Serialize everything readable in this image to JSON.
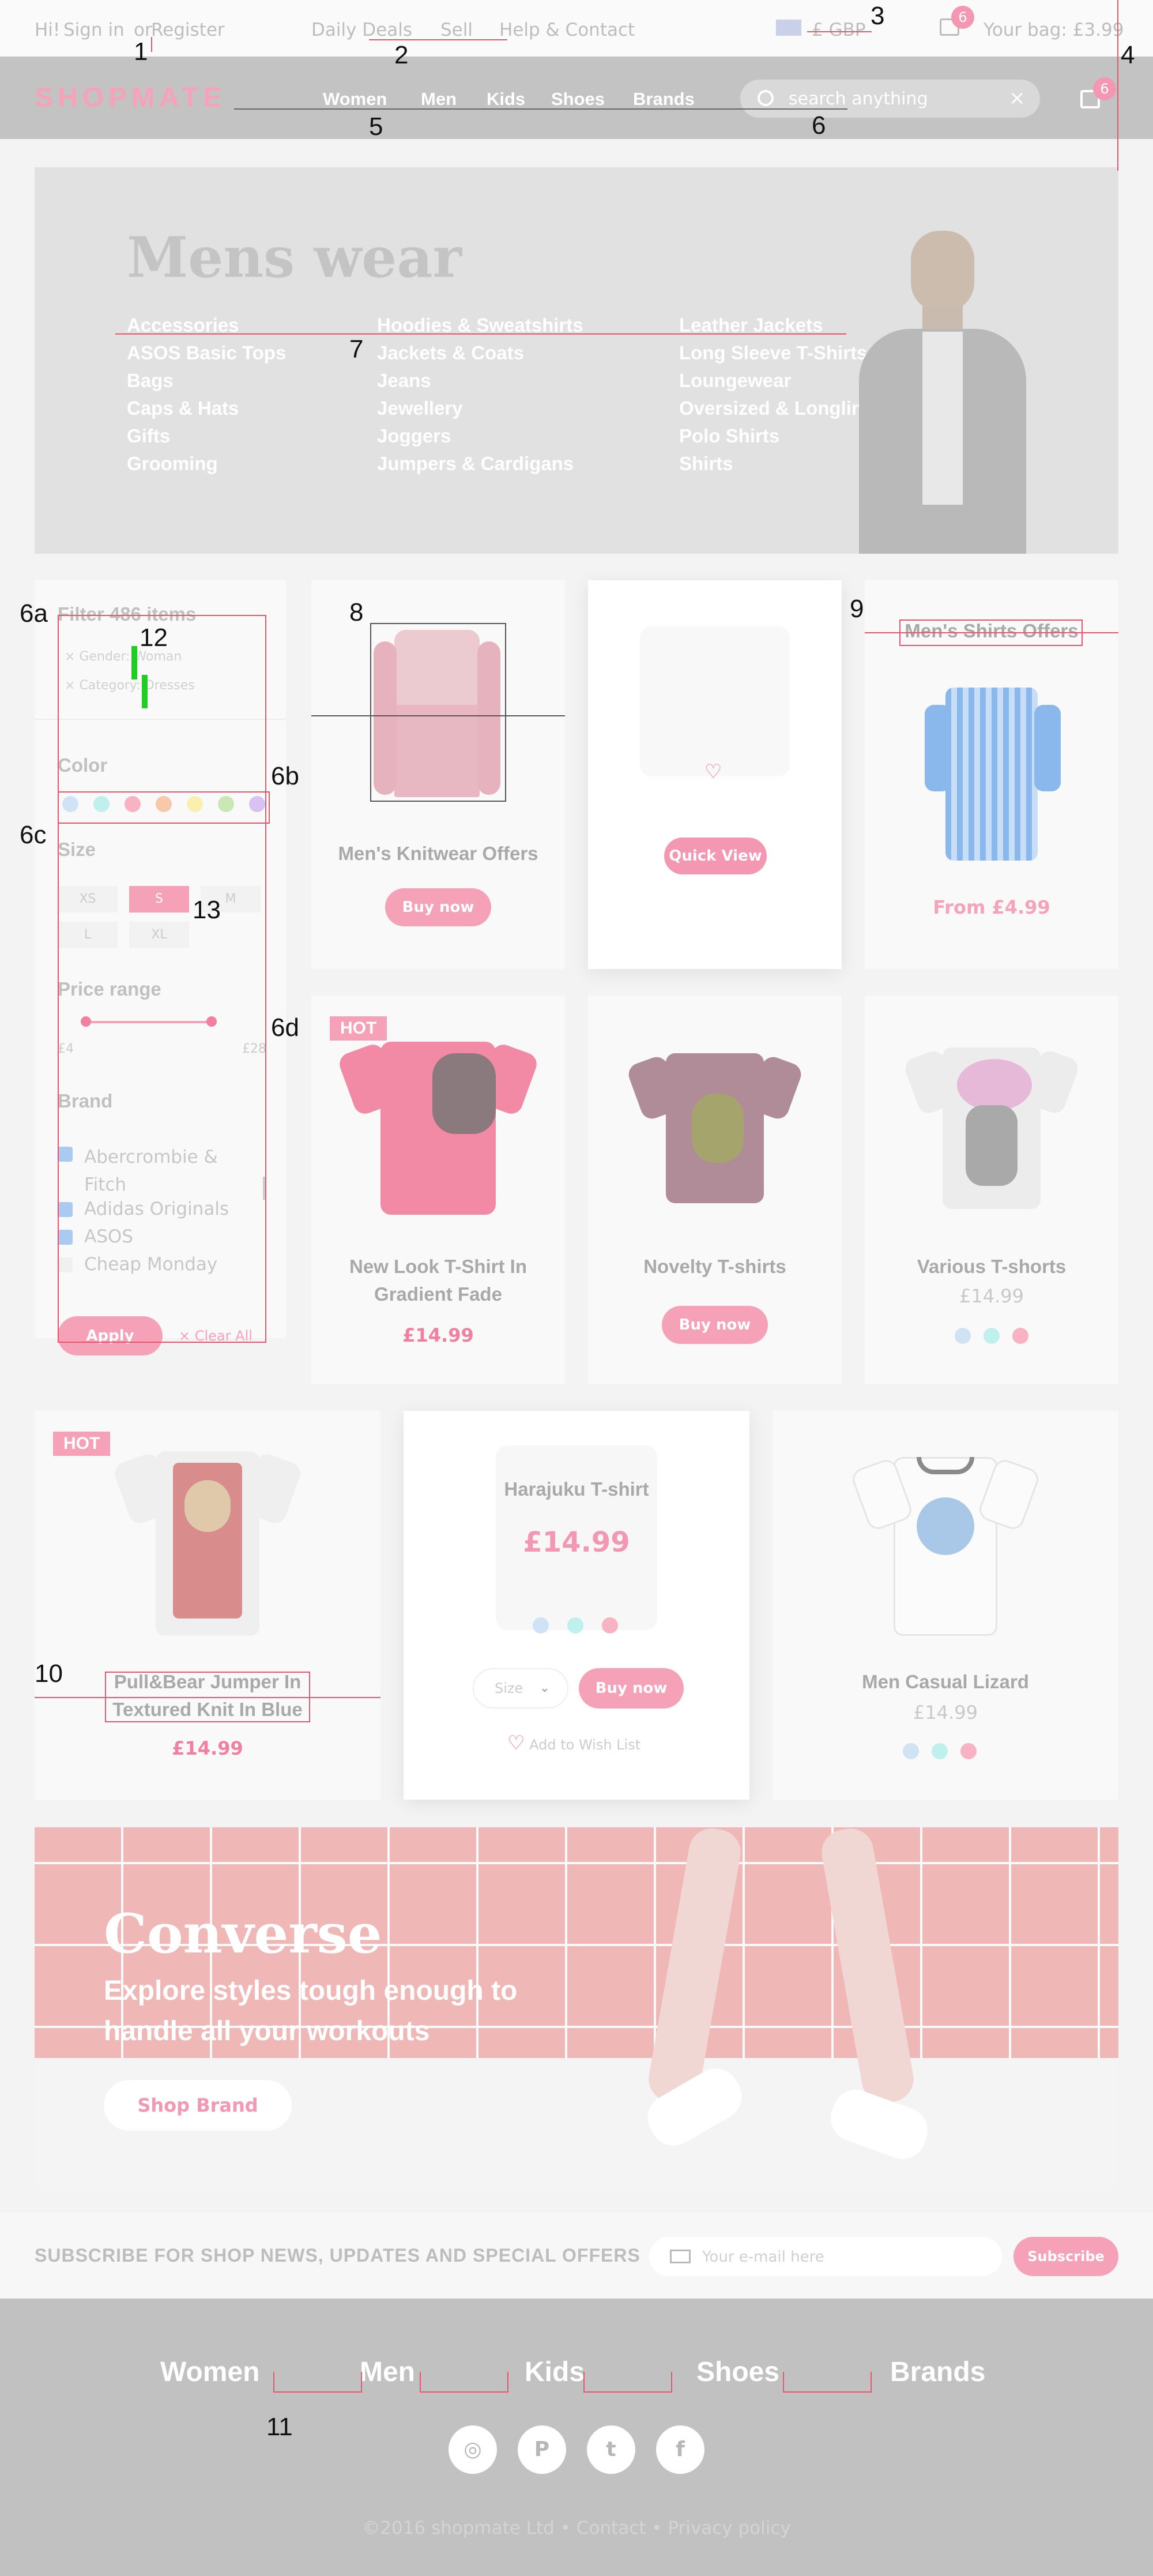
{
  "topbar": {
    "greeting": "Hi!",
    "sign_in": "Sign in",
    "or": "or",
    "register": "Register",
    "daily_deals": "Daily Deals",
    "sell": "Sell",
    "help": "Help & Contact",
    "currency": "£ GBP",
    "bag_count": "6",
    "bag_text": "Your bag: £3.99"
  },
  "nav": {
    "logo": "SHOPMATE",
    "items": [
      "Women",
      "Men",
      "Kids",
      "Shoes",
      "Brands"
    ],
    "search_placeholder": "search anything",
    "bag_count": "6"
  },
  "hero": {
    "title": "Mens wear",
    "col1": [
      "Accessories",
      "ASOS Basic Tops",
      "Bags",
      "Caps & Hats",
      "Gifts",
      "Grooming"
    ],
    "col2": [
      "Hoodies & Sweatshirts",
      "Jackets & Coats",
      "Jeans",
      "Jewellery",
      "Joggers",
      "Jumpers & Cardigans"
    ],
    "col3": [
      "Leather Jackets",
      "Long Sleeve T-Shirts",
      "Loungewear",
      "Oversized & Longline",
      "Polo Shirts",
      "Shirts"
    ]
  },
  "filter": {
    "title": "Filter 486 items",
    "tags": [
      "Gender: Woman",
      "Category: Dresses"
    ],
    "color_label": "Color",
    "colors": [
      "#cfe3f5",
      "#bff0ee",
      "#f7b3c4",
      "#f8c9a8",
      "#f9f0b0",
      "#c9e8b6",
      "#d8c2f3"
    ],
    "size_label": "Size",
    "sizes": [
      "XS",
      "S",
      "M",
      "L",
      "XL"
    ],
    "price_label": "Price range",
    "price_min": "£4",
    "price_max": "£28",
    "brand_label": "Brand",
    "brands": [
      "Abercrombie & Fitch",
      "Adidas Originals",
      "ASOS",
      "Cheap Monday"
    ],
    "brands_checked": [
      1,
      1,
      1,
      0
    ],
    "apply": "Apply",
    "clear": "Clear All"
  },
  "products": {
    "p1": {
      "title": "Men's Knitwear Offers",
      "button": "Buy now"
    },
    "p2": {
      "button": "Quick View"
    },
    "p3": {
      "title": "Men's Shirts Offers",
      "price": "From £4.99"
    },
    "p4": {
      "badge": "HOT",
      "title": "New Look T-Shirt In Gradient Fade",
      "price": "£14.99"
    },
    "p5": {
      "title": "Novelty T-shirts",
      "button": "Buy now"
    },
    "p6": {
      "title": "Various T-shorts",
      "price": "£14.99",
      "colors": [
        "#cfe3f5",
        "#bff0ee",
        "#f7b3c4"
      ]
    },
    "p7": {
      "badge": "HOT",
      "title": "Pull&Bear Jumper In Textured Knit In Blue",
      "price": "£14.99"
    },
    "p8": {
      "title": "Harajuku T-shirt",
      "price": "£14.99",
      "colors": [
        "#cfe3f5",
        "#bff0ee",
        "#f7b3c4"
      ],
      "size": "Size",
      "button": "Buy now",
      "wishlist": "Add to Wish List"
    },
    "p9": {
      "title": "Men Casual Lizard",
      "price": "£14.99",
      "colors": [
        "#cfe3f5",
        "#bff0ee",
        "#f7b3c4"
      ]
    }
  },
  "banner": {
    "title": "Converse",
    "subtitle1": "Explore styles tough enough to",
    "subtitle2": "handle all your workouts",
    "button": "Shop Brand"
  },
  "subscribe": {
    "text": "SUBSCRIBE FOR SHOP NEWS, UPDATES AND SPECIAL OFFERS",
    "placeholder": "Your e-mail here",
    "button": "Subscribe"
  },
  "footer": {
    "items": [
      "Women",
      "Men",
      "Kids",
      "Shoes",
      "Brands"
    ],
    "social": [
      "instagram-icon",
      "pinterest-icon",
      "twitter-icon",
      "facebook-icon"
    ],
    "copyright": "©2016 shopmate Ltd",
    "contact": "Contact",
    "privacy": "Privacy policy"
  },
  "annotations": [
    "1",
    "2",
    "3",
    "4",
    "5",
    "6",
    "7",
    "8",
    "9",
    "10",
    "11",
    "12",
    "13",
    "6a",
    "6b",
    "6c",
    "6d"
  ]
}
